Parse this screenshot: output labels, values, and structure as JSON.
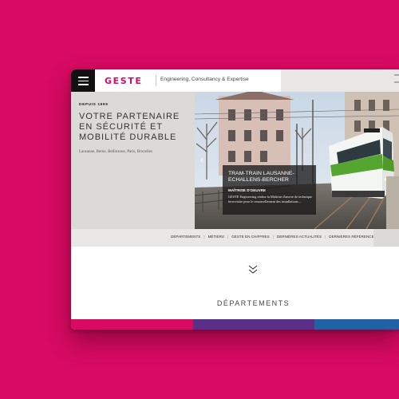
{
  "header": {
    "logo_text": "GESTE",
    "tagline": "Engineering, Consultancy & Expertise"
  },
  "hero": {
    "since": "DEPUIS 1999",
    "headline": "VOTRE PARTENAIRE EN SÉCURITÉ ET MOBILITÉ DURABLE",
    "cities": "Lausanne, Berne, Bellinzone, Paris, Bruxelles"
  },
  "caption": {
    "title": "TRAM-TRAIN LAUSANNE-ECHALLENS-BERCHER",
    "subtitle": "MAÎTRISE D'OEUVRE",
    "body": "GESTE Engineering réalise la Maîtrise d'œuvre de technique ferroviaire pour le renouvellement des installations..."
  },
  "subnav": {
    "items": [
      "Départements",
      "Métiers",
      "Geste en chiffres",
      "Dernières actualités",
      "Dernières références"
    ]
  },
  "sections": {
    "departments_title": "Départements"
  },
  "colors": {
    "background": "#d80a63",
    "brand": "#d80a63",
    "strip_1": "#d80a63",
    "strip_2": "#5a2f8a",
    "strip_3": "#1f63a6"
  },
  "icons": {
    "menu": "hamburger-icon",
    "carousel_prev": "chevron-left-icon",
    "scroll_down": "double-chevron-down-icon"
  }
}
